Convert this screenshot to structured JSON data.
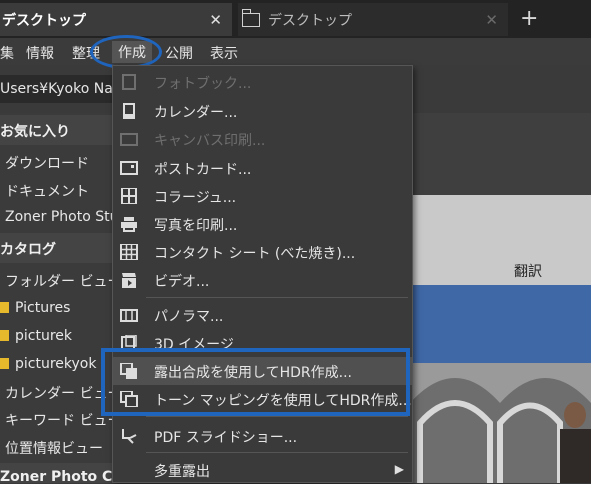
{
  "tabs": [
    {
      "title": "デスクトップ",
      "close": "✕"
    },
    {
      "title": "デスクトップ",
      "close": "✕"
    }
  ],
  "new_tab": "+",
  "menubar": {
    "items": [
      "集",
      "情報",
      "整理",
      "作成",
      "公開",
      "表示"
    ]
  },
  "path": "Users¥Kyoko Nak",
  "sidebar": {
    "favorites_header": "お気に入り",
    "favorites": [
      "ダウンロード",
      "ドキュメント",
      "Zoner Photo Stu"
    ],
    "catalog_header": "カタログ",
    "catalog": [
      "フォルダー ビュー",
      "Pictures",
      "picturek",
      "picturekyok",
      "カレンダー ビュー",
      "キーワード ビュー",
      "位置情報ビュー"
    ],
    "cloud_header": "Zoner Photo Clo"
  },
  "content": {
    "translate_label": "翻訳"
  },
  "menu": {
    "items": [
      {
        "label": "フォトブック...",
        "icon": "photobook-icon",
        "disabled": true
      },
      {
        "label": "カレンダー...",
        "icon": "calendar-icon",
        "disabled": false
      },
      {
        "label": "キャンバス印刷...",
        "icon": "canvas-icon",
        "disabled": true
      },
      {
        "label": "ポストカード...",
        "icon": "postcard-icon",
        "disabled": false
      },
      {
        "label": "コラージュ...",
        "icon": "collage-icon",
        "disabled": false
      },
      {
        "label": "写真を印刷...",
        "icon": "print-icon",
        "disabled": false
      },
      {
        "label": "コンタクト シート (べた焼き)...",
        "icon": "contact-sheet-icon",
        "disabled": false
      },
      {
        "label": "ビデオ...",
        "icon": "video-icon",
        "disabled": false
      },
      {
        "label": "パノラマ...",
        "icon": "panorama-icon",
        "disabled": false
      },
      {
        "label": "3D イメージ",
        "icon": "3d-image-icon",
        "disabled": false
      },
      {
        "label": "露出合成を使用してHDR作成...",
        "icon": "hdr-exposure-icon",
        "disabled": false
      },
      {
        "label": "トーン マッピングを使用してHDR作成...",
        "icon": "hdr-tonemap-icon",
        "disabled": false
      },
      {
        "label": "PDF スライドショー...",
        "icon": "pdf-slideshow-icon",
        "disabled": false
      },
      {
        "label": "多重露出",
        "icon": "",
        "disabled": false,
        "submenu": "▶"
      }
    ]
  }
}
